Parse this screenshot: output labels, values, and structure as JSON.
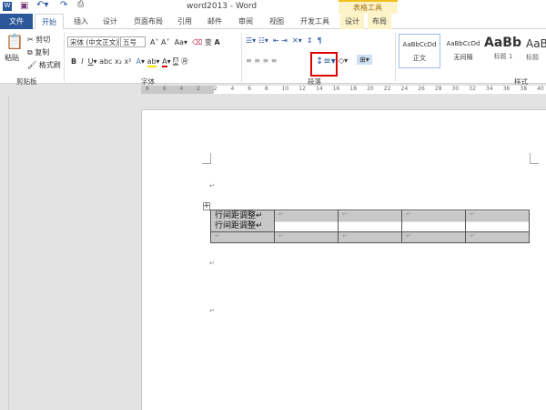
{
  "window": {
    "title": "word2013 - Word"
  },
  "context_tab_group": "表格工具",
  "tabs": [
    "文件",
    "开始",
    "插入",
    "设计",
    "页面布局",
    "引用",
    "邮件",
    "审阅",
    "视图",
    "开发工具",
    "设计",
    "布局"
  ],
  "active_tab": "开始",
  "clipboard": {
    "paste": "粘贴",
    "cut": "剪切",
    "copy": "复制",
    "format_painter": "格式刷",
    "group": "剪贴板"
  },
  "font": {
    "name": "宋体 (中文正文)",
    "size": "五号",
    "group": "字体"
  },
  "paragraph": {
    "group": "段落",
    "highlighted_button": "line-spacing"
  },
  "styles": {
    "items": [
      {
        "preview": "AaBbCcDd",
        "label": "正文"
      },
      {
        "preview": "AaBbCcDd",
        "label": "无间隔"
      },
      {
        "preview": "AaBb",
        "label": "标题 1"
      },
      {
        "preview": "AaB",
        "label": "标题"
      }
    ],
    "group": "样式"
  },
  "ruler": [
    "8",
    "6",
    "4",
    "2",
    "2",
    "4",
    "6",
    "8",
    "10",
    "12",
    "14",
    "16",
    "18",
    "20",
    "22",
    "24",
    "26",
    "28",
    "30",
    "32",
    "34",
    "36",
    "38",
    "40"
  ],
  "table": {
    "rows": [
      [
        "行间距调整\n行间距调整",
        "",
        "",
        "",
        ""
      ],
      [
        "",
        "",
        "",
        "",
        ""
      ]
    ]
  },
  "table_text": {
    "line1": "行间距调整↵",
    "line2": "行间距调整↵",
    "mark": "↵"
  },
  "paragraph_mark": "↵",
  "colors": {
    "file_tab": "#2b579a",
    "context": "#fdf3c9",
    "highlight_box": "#e00000"
  }
}
